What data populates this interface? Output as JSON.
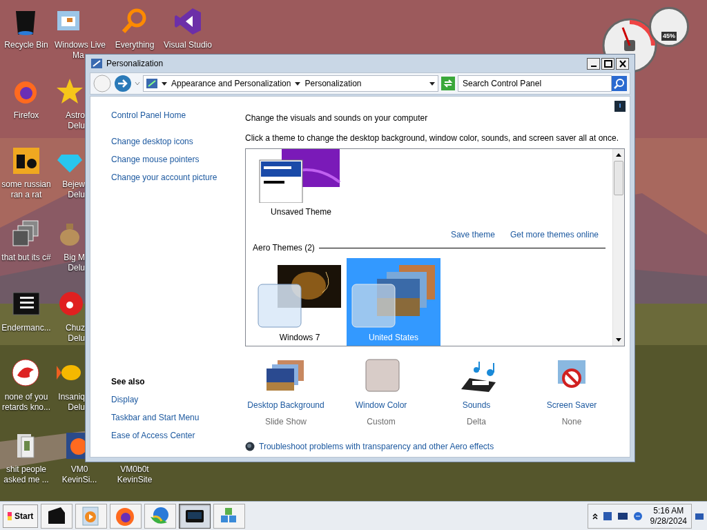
{
  "desktop_icons": [
    {
      "lines": [
        "Recycle Bin"
      ]
    },
    {
      "lines": [
        "Firefox"
      ]
    },
    {
      "lines": [
        "some russian",
        "ran a rat"
      ]
    },
    {
      "lines": [
        "that but its c#"
      ]
    },
    {
      "lines": [
        "Endermanc..."
      ]
    },
    {
      "lines": [
        "none of you",
        "retards kno..."
      ]
    },
    {
      "lines": [
        "shit people",
        "asked me ..."
      ]
    },
    {
      "lines": [
        "Windows Live",
        "Ma"
      ]
    },
    {
      "lines": [
        "Astro",
        "Delu"
      ]
    },
    {
      "lines": [
        "Bejew",
        "Delu"
      ]
    },
    {
      "lines": [
        "Big M",
        "Delu"
      ]
    },
    {
      "lines": [
        "Chuz",
        "Delu"
      ]
    },
    {
      "lines": [
        "Insaniq",
        "Delu"
      ]
    },
    {
      "lines": [
        "VM0",
        "KevinSi..."
      ]
    },
    {
      "lines": [
        "Everything"
      ]
    },
    {
      "lines": [
        "VM0b0t",
        "KevinSite"
      ]
    },
    {
      "lines": [
        "Visual Studio"
      ]
    }
  ],
  "gadget": {
    "reading": "45%"
  },
  "window": {
    "title": "Personalization",
    "breadcrumb": [
      "Appearance and Personalization",
      "Personalization"
    ],
    "search": {
      "placeholder": "Search Control Panel"
    },
    "sidebar": {
      "home": "Control Panel Home",
      "links": [
        "Change desktop icons",
        "Change mouse pointers",
        "Change your account picture"
      ],
      "see_also_heading": "See also",
      "see_also": [
        "Display",
        "Taskbar and Start Menu",
        "Ease of Access Center"
      ]
    },
    "heading": "Change the visuals and sounds on your computer",
    "description": "Click a theme to change the desktop background, window color, sounds, and screen saver all at once.",
    "unsaved_theme": {
      "label": "Unsaved Theme",
      "selected": false
    },
    "theme_links": [
      "Save theme",
      "Get more themes online"
    ],
    "group_heading": "Aero Themes (2)",
    "themes": [
      {
        "label": "Windows 7",
        "selected": false
      },
      {
        "label": "United States",
        "selected": true
      }
    ],
    "settings": [
      {
        "title": "Desktop Background",
        "value": "Slide Show"
      },
      {
        "title": "Window Color",
        "value": "Custom"
      },
      {
        "title": "Sounds",
        "value": "Delta"
      },
      {
        "title": "Screen Saver",
        "value": "None"
      }
    ],
    "troubleshoot": "Troubleshoot problems with transparency and other Aero effects"
  },
  "taskbar": {
    "start": "Start",
    "apps": [
      {
        "selected": false
      },
      {
        "selected": false
      },
      {
        "selected": false
      },
      {
        "selected": false
      },
      {
        "selected": true
      },
      {
        "selected": false
      }
    ],
    "time": "5:16 AM",
    "date": "9/28/2024"
  }
}
